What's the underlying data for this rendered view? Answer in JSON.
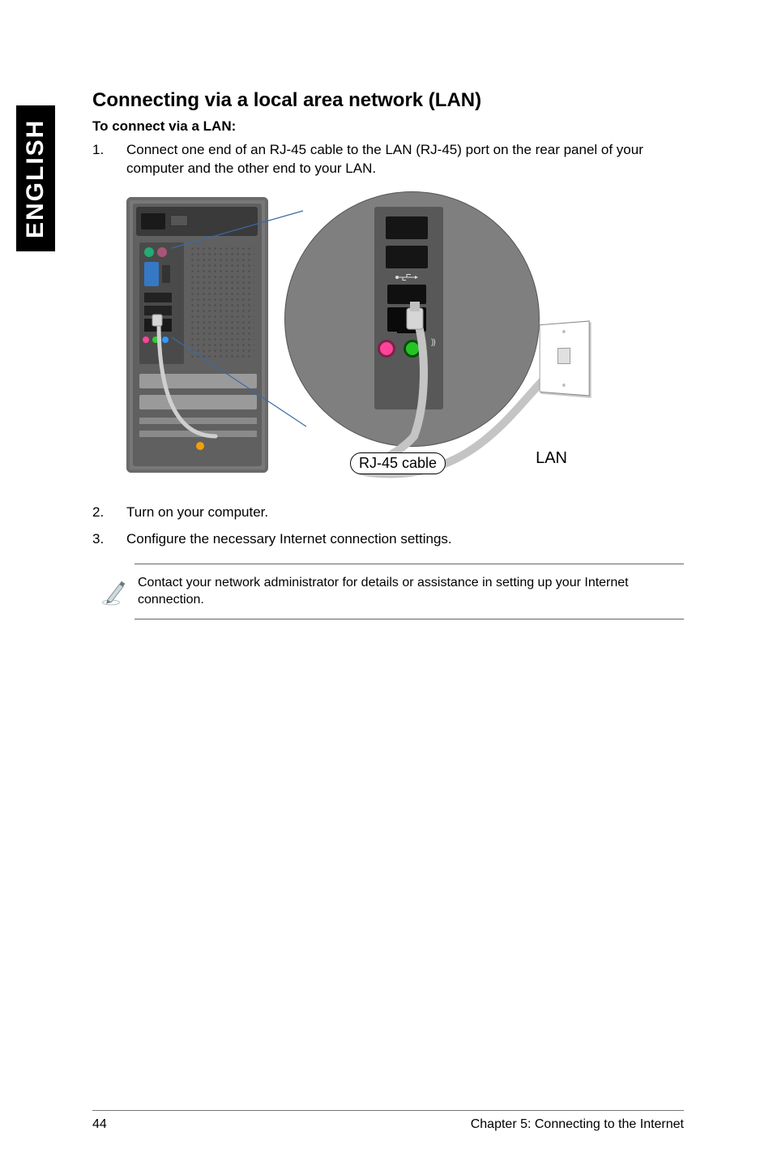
{
  "sideTab": "ENGLISH",
  "heading": "Connecting via a local area network (LAN)",
  "subhead": "To connect via a LAN:",
  "steps": [
    "Connect one end of an RJ-45 cable to the LAN (RJ-45) port on the rear panel of your computer and the other end to your LAN.",
    "Turn on your computer.",
    "Configure the necessary Internet connection settings."
  ],
  "figure": {
    "cableLabel": "RJ-45 cable",
    "lanLabel": "LAN"
  },
  "note": "Contact your network administrator for details or assistance in setting up your Internet connection.",
  "footer": {
    "pageNumber": "44",
    "chapter": "Chapter 5: Connecting to the Internet"
  }
}
